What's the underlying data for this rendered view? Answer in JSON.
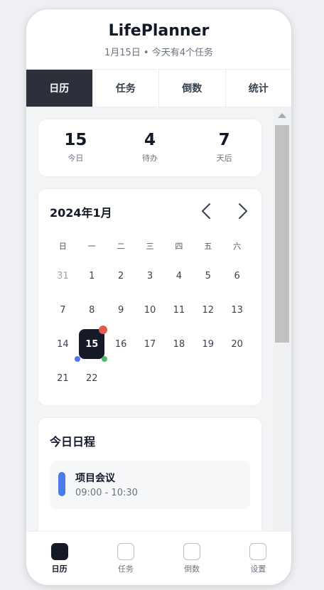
{
  "header": {
    "title": "LifePlanner",
    "subtitle": "1月15日 • 今天有4个任务"
  },
  "tabs": [
    {
      "label": "日历",
      "active": true
    },
    {
      "label": "任务",
      "active": false
    },
    {
      "label": "倒数",
      "active": false
    },
    {
      "label": "统计",
      "active": false
    }
  ],
  "stats": [
    {
      "value": "15",
      "label": "今日"
    },
    {
      "value": "4",
      "label": "待办"
    },
    {
      "value": "7",
      "label": "天后"
    }
  ],
  "calendar": {
    "title": "2024年1月",
    "weekdays": [
      "日",
      "一",
      "二",
      "三",
      "四",
      "五",
      "六"
    ],
    "weeks": [
      [
        "31",
        "1",
        "2",
        "3",
        "4",
        "5",
        "6"
      ],
      [
        "7",
        "8",
        "9",
        "10",
        "11",
        "12",
        "13"
      ],
      [
        "14",
        "15",
        "16",
        "17",
        "18",
        "19",
        "20"
      ],
      [
        "21",
        "22",
        "",
        "",
        "",
        "",
        ""
      ]
    ],
    "muted_day": "31",
    "selected_day": "15",
    "marker_colors": {
      "red": "#e05a4f",
      "blue": "#4a7be8",
      "green": "#4cba6a"
    }
  },
  "schedule": {
    "title": "今日日程",
    "events": [
      {
        "name": "项目会议",
        "time": "09:00 - 10:30",
        "color": "#4a7be8"
      }
    ]
  },
  "bottom_nav": [
    {
      "label": "日历",
      "active": true
    },
    {
      "label": "任务",
      "active": false
    },
    {
      "label": "倒数",
      "active": false
    },
    {
      "label": "设置",
      "active": false
    }
  ]
}
